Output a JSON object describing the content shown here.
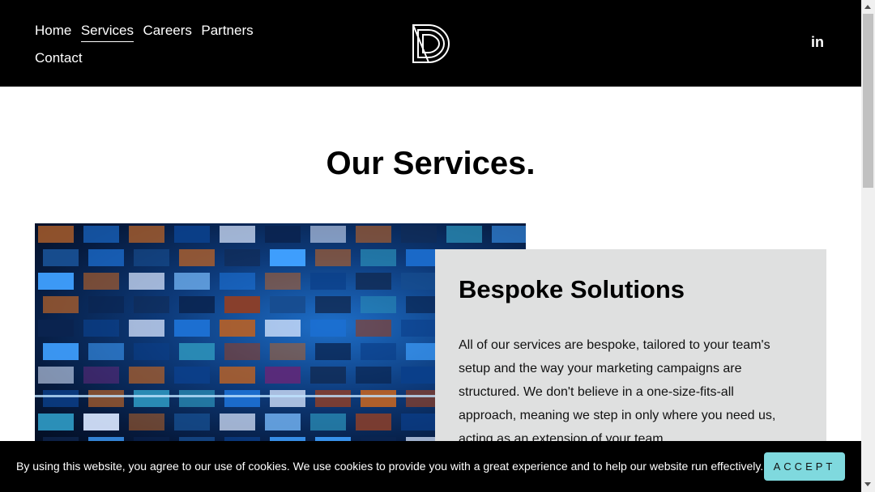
{
  "header": {
    "nav": [
      {
        "label": "Home",
        "active": false
      },
      {
        "label": "Services",
        "active": true
      },
      {
        "label": "Careers",
        "active": false
      },
      {
        "label": "Partners",
        "active": false
      },
      {
        "label": "Contact",
        "active": false
      }
    ],
    "social_label": "in",
    "logo_icon": "dd-logo-icon",
    "colors": {
      "background": "#000000",
      "text": "#ffffff"
    }
  },
  "main": {
    "title": "Our Services.",
    "card": {
      "title": "Bespoke Solutions",
      "body": "All of our services are bespoke, tailored to your team's setup and the way your marketing campaigns are structured. We don't believe in a one-size-fits-all approach, meaning we step in only where you need us, acting as an extension of your team.",
      "background": "#dfe0e0"
    }
  },
  "cookie": {
    "text": "By using this website, you agree to our use of cookies. We use cookies to provide you with a great experience and to help our website run effectively.",
    "accept_label": "ACCEPT",
    "accent": "#7fd9de"
  }
}
